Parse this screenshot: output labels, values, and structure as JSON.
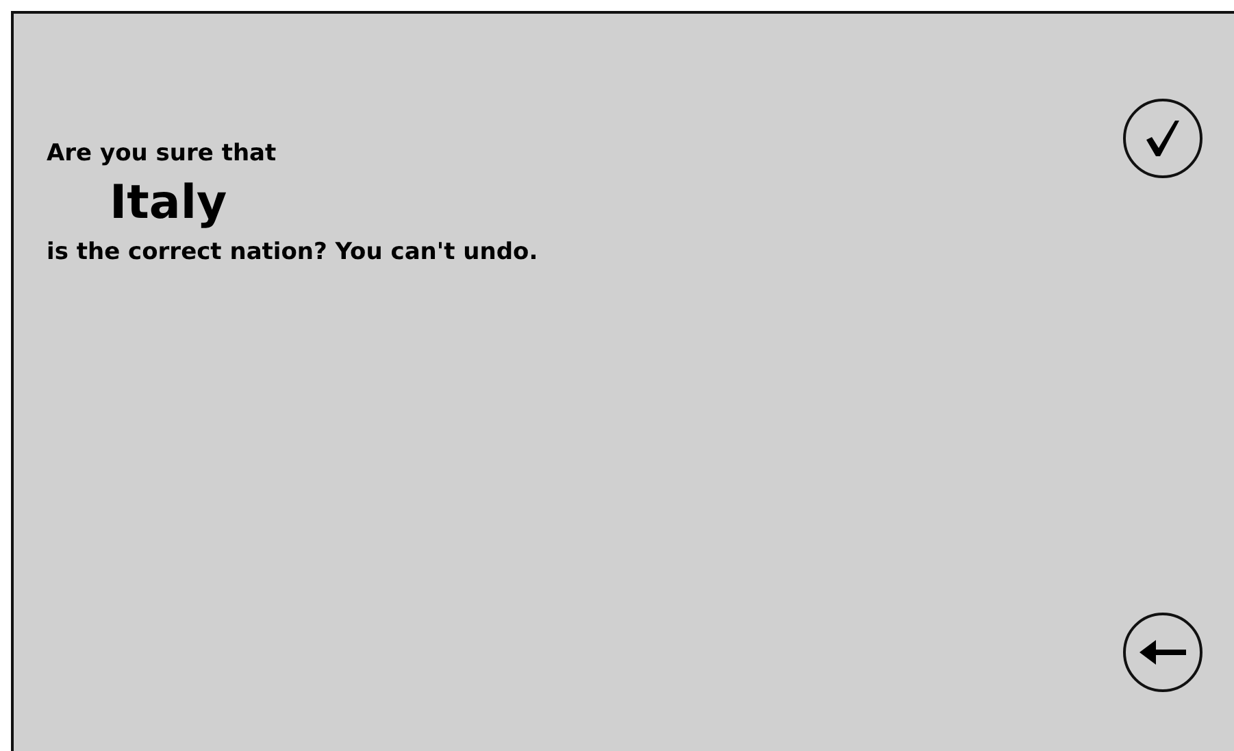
{
  "dialog": {
    "prompt": "Are you sure that",
    "nation": "Italy",
    "question": "is the correct nation? You can't undo."
  },
  "buttons": [
    {
      "kind": "confirm"
    },
    {
      "kind": "back"
    }
  ]
}
